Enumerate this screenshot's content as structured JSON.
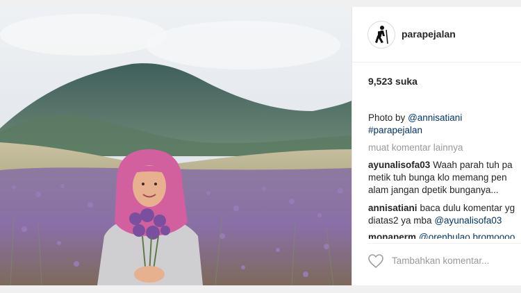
{
  "post": {
    "username": "parapejalan",
    "likes_count": "9,523",
    "likes_label": "suka",
    "caption": {
      "prefix": "Photo by",
      "mention": "@annisatiani",
      "hashtag": "#parapejalan"
    },
    "load_more": "muat komentar lainnya",
    "comments": [
      {
        "author": "ayunalisofa03",
        "line1": "Waah parah tuh pa",
        "line2": "metik tuh bunga klo memang pen",
        "line3": "alam jangan dpetik bunganya..."
      },
      {
        "author": "annisatiani",
        "line1": "baca dulu komentar yg",
        "line2_prefix": "diatas2 ya mba",
        "line2_mention": "@ayunalisofa03"
      },
      {
        "author": "monaperm",
        "line1": "@orenbulao bromoooo"
      }
    ],
    "add_comment_placeholder": "Tambahkan komentar...",
    "icons": {
      "avatar": "hiker-icon",
      "like": "heart-icon"
    }
  },
  "colors": {
    "link": "#003569",
    "muted": "#999999",
    "text": "#262626",
    "hijab": "#d2609f",
    "flowers": "#8a6aa8"
  }
}
